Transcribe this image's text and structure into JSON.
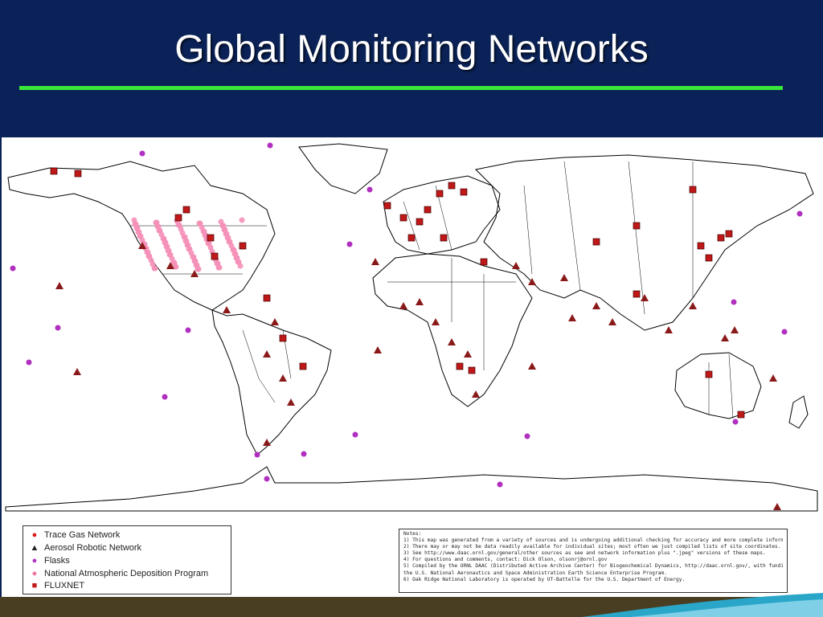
{
  "slide": {
    "title": "Global Monitoring Networks",
    "background_color": "#0a2257",
    "rule_color": "#39e639"
  },
  "legend": {
    "items": [
      {
        "label": "Trace Gas Network",
        "symbol": "circle",
        "color": "#e01818"
      },
      {
        "label": "Aerosol Robotic Network",
        "symbol": "triangle",
        "color": "#222222"
      },
      {
        "label": "Flasks",
        "symbol": "circle",
        "color": "#b030c0"
      },
      {
        "label": "National Atmospheric Deposition Program",
        "symbol": "circle",
        "color": "#f070a0"
      },
      {
        "label": "FLUXNET",
        "symbol": "square",
        "color": "#c01818"
      }
    ]
  },
  "notes": {
    "heading": "Notes:",
    "lines": [
      "1) This map was generated from a variety of sources and is undergoing additional checking for accuracy and more complete information.",
      "2) There may or may not be data readily available for individual sites; most often we just compiled lists of site coordinates.",
      "3) See http://www.daac.ornl.gov/general/other sources as see and network information plus \".jpeg\" versions of these maps.",
      "4) For questions and comments, contact: Dick Olson, olsonrj@ornl.gov",
      "5) Compiled by the ORNL DAAC (Distributed Active Archive Center) for Biogeochemical Dynamics, http://daac.ornl.gov/, with funding by",
      "   the U.S. National Aeronautics and Space Administration Earth Science Enterprise Program.",
      "6) Oak Ridge National Laboratory is operated by UT-Battelle for the U.S. Department of Energy."
    ]
  },
  "map": {
    "land_color": "#ffffff",
    "border_color": "#000000",
    "marker_colors": {
      "fluxnet": "#c01818",
      "aeronet": "#8a1a1a",
      "flask": "#b030c0",
      "nadp": "#f590b8",
      "trace_gas": "#e01818"
    }
  }
}
